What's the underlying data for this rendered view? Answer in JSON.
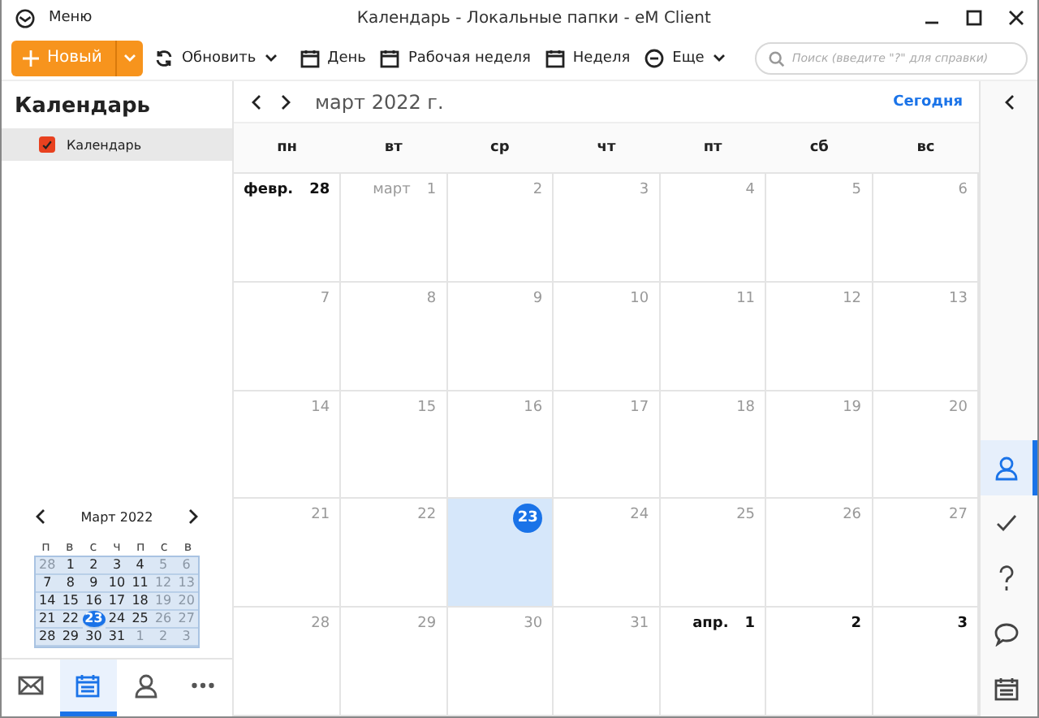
{
  "window": {
    "menu": "Меню",
    "title": "Календарь - Локальные папки - eM Client"
  },
  "toolbar": {
    "new_button": "Новый",
    "refresh_button": "Обновить",
    "views": [
      {
        "label": "День",
        "kind": "day"
      },
      {
        "label": "Рабочая неделя",
        "kind": "week"
      },
      {
        "label": "Неделя",
        "kind": "week"
      },
      {
        "label": "Еще",
        "kind": "more"
      }
    ],
    "search": {
      "placeholder": "Поиск (введите \"?\" для справки)"
    }
  },
  "sidebar": {
    "title": "Календарь",
    "items": [
      {
        "label": "Календарь",
        "checked": true,
        "selected": true
      }
    ],
    "mini_calendar": {
      "title": "Март 2022",
      "weekdays": [
        "п",
        "в",
        "с",
        "ч",
        "п",
        "с",
        "в"
      ],
      "days": [
        {
          "day": "28",
          "muted": true,
          "selected": false
        },
        {
          "day": "1",
          "muted": false,
          "selected": false
        },
        {
          "day": "2",
          "muted": false,
          "selected": false
        },
        {
          "day": "3",
          "muted": false,
          "selected": false
        },
        {
          "day": "4",
          "muted": false,
          "selected": false
        },
        {
          "day": "5",
          "muted": true,
          "selected": false
        },
        {
          "day": "6",
          "muted": true,
          "selected": false
        },
        {
          "day": "7",
          "muted": false,
          "selected": false
        },
        {
          "day": "8",
          "muted": false,
          "selected": false
        },
        {
          "day": "9",
          "muted": false,
          "selected": false
        },
        {
          "day": "10",
          "muted": false,
          "selected": false
        },
        {
          "day": "11",
          "muted": false,
          "selected": false
        },
        {
          "day": "12",
          "muted": true,
          "selected": false
        },
        {
          "day": "13",
          "muted": true,
          "selected": false
        },
        {
          "day": "14",
          "muted": false,
          "selected": false
        },
        {
          "day": "15",
          "muted": false,
          "selected": false
        },
        {
          "day": "16",
          "muted": false,
          "selected": false
        },
        {
          "day": "17",
          "muted": false,
          "selected": false
        },
        {
          "day": "18",
          "muted": false,
          "selected": false
        },
        {
          "day": "19",
          "muted": true,
          "selected": false
        },
        {
          "day": "20",
          "muted": true,
          "selected": false
        },
        {
          "day": "21",
          "muted": false,
          "selected": false
        },
        {
          "day": "22",
          "muted": false,
          "selected": false
        },
        {
          "day": "23",
          "muted": false,
          "selected": true
        },
        {
          "day": "24",
          "muted": false,
          "selected": false
        },
        {
          "day": "25",
          "muted": false,
          "selected": false
        },
        {
          "day": "26",
          "muted": true,
          "selected": false
        },
        {
          "day": "27",
          "muted": true,
          "selected": false
        },
        {
          "day": "28",
          "muted": false,
          "selected": false
        },
        {
          "day": "29",
          "muted": false,
          "selected": false
        },
        {
          "day": "30",
          "muted": false,
          "selected": false
        },
        {
          "day": "31",
          "muted": false,
          "selected": false
        },
        {
          "day": "1",
          "muted": true,
          "selected": false
        },
        {
          "day": "2",
          "muted": true,
          "selected": false
        },
        {
          "day": "3",
          "muted": true,
          "selected": false
        }
      ]
    },
    "nav": [
      {
        "kind": "mail",
        "selected": false
      },
      {
        "kind": "calendar",
        "selected": true
      },
      {
        "kind": "contacts",
        "selected": false
      },
      {
        "kind": "more",
        "selected": false
      }
    ]
  },
  "calendar": {
    "month_title": "март 2022 г.",
    "today_button": "Сегодня",
    "weekdays": [
      "пн",
      "вт",
      "ср",
      "чт",
      "пт",
      "сб",
      "вс"
    ],
    "days": [
      {
        "month_label": "февр.",
        "day": "28",
        "emphasis": true,
        "selected": false
      },
      {
        "month_label": "март",
        "day": "1",
        "emphasis": false,
        "selected": false
      },
      {
        "day": "2",
        "emphasis": false,
        "selected": false
      },
      {
        "day": "3",
        "emphasis": false,
        "selected": false
      },
      {
        "day": "4",
        "emphasis": false,
        "selected": false
      },
      {
        "day": "5",
        "emphasis": false,
        "selected": false
      },
      {
        "day": "6",
        "emphasis": false,
        "selected": false
      },
      {
        "day": "7",
        "emphasis": false,
        "selected": false
      },
      {
        "day": "8",
        "emphasis": false,
        "selected": false
      },
      {
        "day": "9",
        "emphasis": false,
        "selected": false
      },
      {
        "day": "10",
        "emphasis": false,
        "selected": false
      },
      {
        "day": "11",
        "emphasis": false,
        "selected": false
      },
      {
        "day": "12",
        "emphasis": false,
        "selected": false
      },
      {
        "day": "13",
        "emphasis": false,
        "selected": false
      },
      {
        "day": "14",
        "emphasis": false,
        "selected": false
      },
      {
        "day": "15",
        "emphasis": false,
        "selected": false
      },
      {
        "day": "16",
        "emphasis": false,
        "selected": false
      },
      {
        "day": "17",
        "emphasis": false,
        "selected": false
      },
      {
        "day": "18",
        "emphasis": false,
        "selected": false
      },
      {
        "day": "19",
        "emphasis": false,
        "selected": false
      },
      {
        "day": "20",
        "emphasis": false,
        "selected": false
      },
      {
        "day": "21",
        "emphasis": false,
        "selected": false
      },
      {
        "day": "22",
        "emphasis": false,
        "selected": false
      },
      {
        "day": "23",
        "emphasis": false,
        "selected": true
      },
      {
        "day": "24",
        "emphasis": false,
        "selected": false
      },
      {
        "day": "25",
        "emphasis": false,
        "selected": false
      },
      {
        "day": "26",
        "emphasis": false,
        "selected": false
      },
      {
        "day": "27",
        "emphasis": false,
        "selected": false
      },
      {
        "day": "28",
        "emphasis": false,
        "selected": false
      },
      {
        "day": "29",
        "emphasis": false,
        "selected": false
      },
      {
        "day": "30",
        "emphasis": false,
        "selected": false
      },
      {
        "day": "31",
        "emphasis": false,
        "selected": false
      },
      {
        "month_label": "апр.",
        "day": "1",
        "emphasis": true,
        "selected": false
      },
      {
        "day": "2",
        "emphasis": true,
        "selected": false
      },
      {
        "day": "3",
        "emphasis": true,
        "selected": false
      }
    ]
  },
  "right_rail": [
    {
      "kind": "contacts",
      "selected": true
    },
    {
      "kind": "tasks",
      "selected": false
    },
    {
      "kind": "help",
      "selected": false
    },
    {
      "kind": "chat",
      "selected": false
    },
    {
      "kind": "calendar",
      "selected": false
    }
  ]
}
